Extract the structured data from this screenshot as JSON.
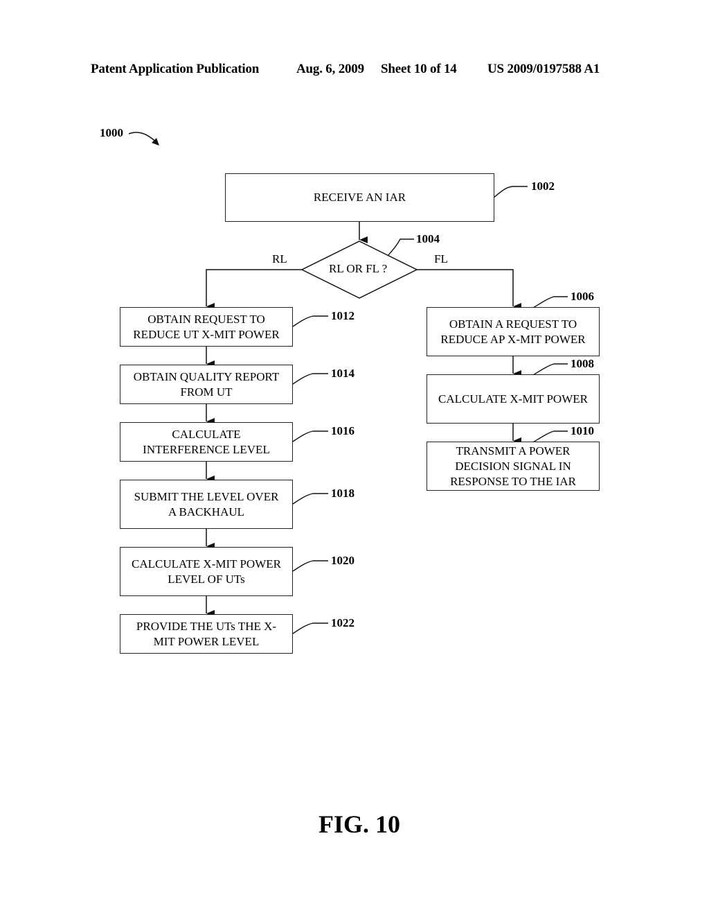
{
  "header": {
    "publication": "Patent Application Publication",
    "date": "Aug. 6, 2009",
    "sheet": "Sheet 10 of 14",
    "number": "US 2009/0197588 A1"
  },
  "figure": {
    "ref": "1000",
    "caption": "FIG. 10"
  },
  "flowchart": {
    "start": {
      "id": "1002",
      "text": "RECEIVE AN IAR"
    },
    "decision": {
      "id": "1004",
      "text": "RL OR FL ?",
      "left_label": "RL",
      "right_label": "FL"
    },
    "rl_steps": [
      {
        "id": "1012",
        "text": "OBTAIN REQUEST TO\nREDUCE UT X-MIT POWER"
      },
      {
        "id": "1014",
        "text": "OBTAIN QUALITY REPORT\nFROM UT"
      },
      {
        "id": "1016",
        "text": "CALCULATE\nINTERFERENCE LEVEL"
      },
      {
        "id": "1018",
        "text": "SUBMIT THE LEVEL OVER\nA BACKHAUL"
      },
      {
        "id": "1020",
        "text": "CALCULATE X-MIT POWER\nLEVEL OF UTs"
      },
      {
        "id": "1022",
        "text": "PROVIDE THE UTs THE X-\nMIT POWER LEVEL"
      }
    ],
    "fl_steps": [
      {
        "id": "1006",
        "text": "OBTAIN A REQUEST TO\nREDUCE AP X-MIT POWER"
      },
      {
        "id": "1008",
        "text": "CALCULATE X-MIT POWER"
      },
      {
        "id": "1010",
        "text": "TRANSMIT A POWER\nDECISION SIGNAL IN\nRESPONSE TO THE IAR"
      }
    ]
  }
}
